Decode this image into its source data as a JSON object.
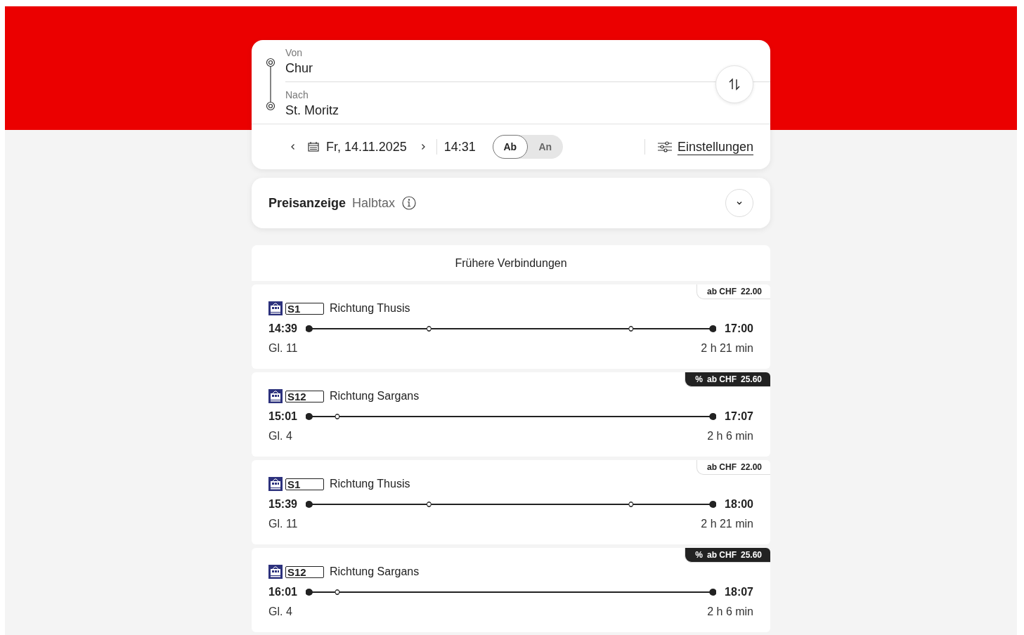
{
  "search": {
    "from_label": "Von",
    "from": "Chur",
    "to_label": "Nach",
    "to": "St. Moritz",
    "date": "Fr, 14.11.2025",
    "time": "14:31",
    "modes": [
      {
        "label": "Ab",
        "selected": true
      },
      {
        "label": "An",
        "selected": false
      }
    ],
    "settings": "Einstellungen"
  },
  "price_display": {
    "title": "Preisanzeige",
    "value": "Halbtax"
  },
  "earlier": "Frühere Verbindungen",
  "connections": [
    {
      "line": "S1",
      "direction": "Richtung Thusis",
      "departure": "14:39",
      "arrival": "17:00",
      "platform": "Gl. 11",
      "duration": "2 h 21 min",
      "stops": [
        {
          "kind": "halt"
        },
        {
          "kind": "halt"
        }
      ],
      "price": {
        "discount": false,
        "label": "ab CHF",
        "amount": "22.00"
      }
    },
    {
      "line": "S12",
      "direction": "Richtung Sargans",
      "departure": "15:01",
      "arrival": "17:07",
      "platform": "Gl. 4",
      "duration": "2 h 6 min",
      "stops": [
        {
          "kind": "halt"
        }
      ],
      "price": {
        "discount": true,
        "symbol": "%",
        "label": "ab CHF",
        "amount": "25.60"
      }
    },
    {
      "line": "S1",
      "direction": "Richtung Thusis",
      "departure": "15:39",
      "arrival": "18:00",
      "platform": "Gl. 11",
      "duration": "2 h 21 min",
      "stops": [
        {
          "kind": "halt"
        },
        {
          "kind": "halt"
        }
      ],
      "price": {
        "discount": false,
        "label": "ab CHF",
        "amount": "22.00"
      }
    },
    {
      "line": "S12",
      "direction": "Richtung Sargans",
      "departure": "16:01",
      "arrival": "18:07",
      "platform": "Gl. 4",
      "duration": "2 h 6 min",
      "stops": [
        {
          "kind": "halt"
        }
      ],
      "price": {
        "discount": true,
        "symbol": "%",
        "label": "ab CHF",
        "amount": "25.60"
      }
    }
  ]
}
